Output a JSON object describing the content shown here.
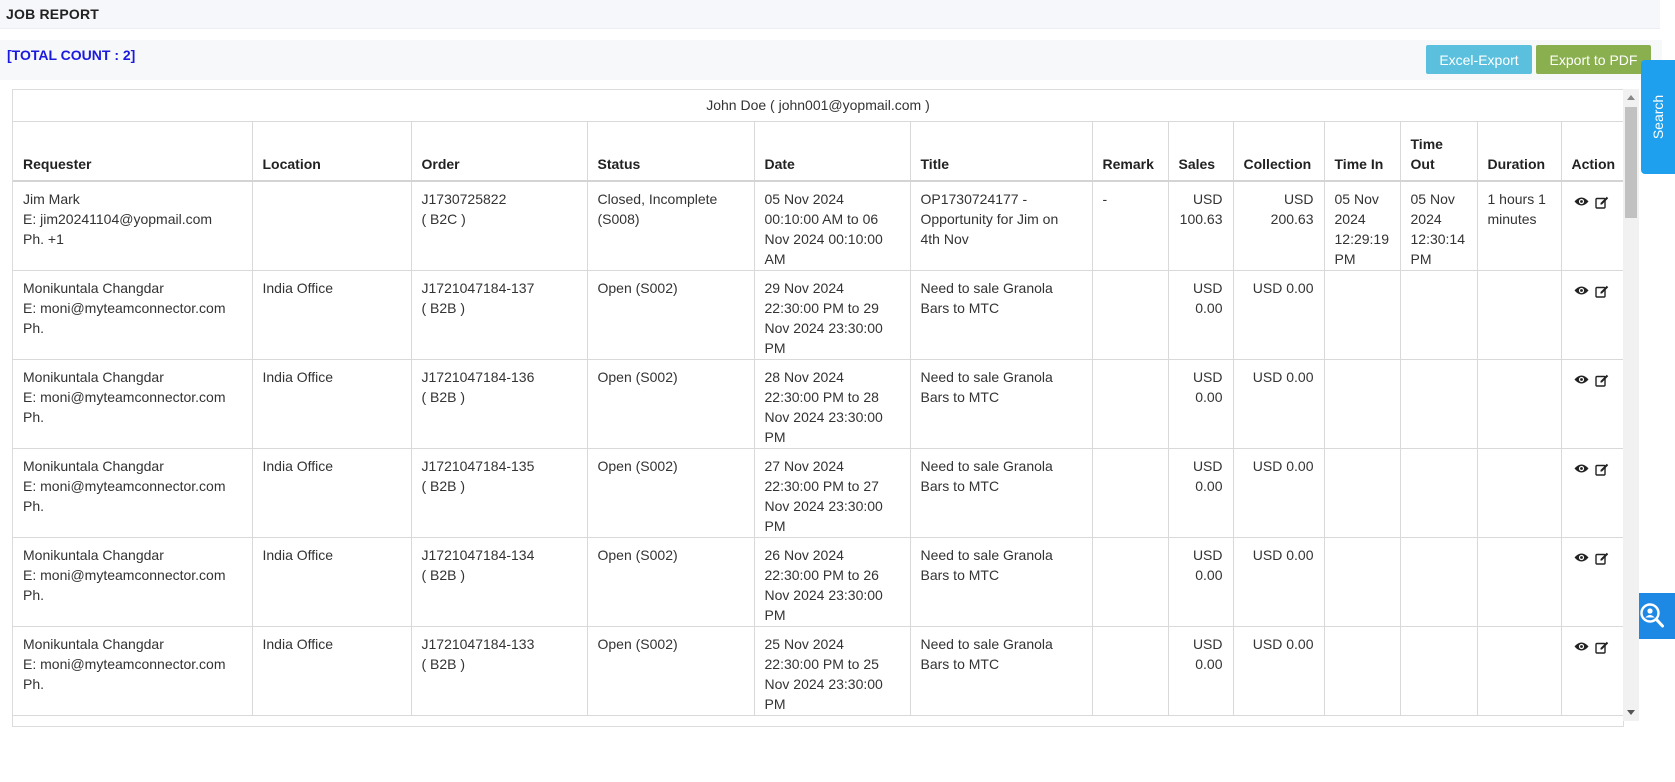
{
  "header": {
    "title": "JOB REPORT"
  },
  "summary": {
    "total_count": "[TOTAL COUNT : 2]"
  },
  "toolbar": {
    "excel_label": "Excel-Export",
    "pdf_label": "Export to PDF"
  },
  "side_tabs": {
    "search_label": "Search",
    "zoom_icon": "zoom-search-icon"
  },
  "table": {
    "group_header": "John Doe ( john001@yopmail.com )",
    "columns": [
      "Requester",
      "Location",
      "Order",
      "Status",
      "Date",
      "Title",
      "Remark",
      "Sales",
      "Collection",
      "Time In",
      "Time Out",
      "Duration",
      "Action"
    ],
    "rows": [
      {
        "req_name": "Jim Mark",
        "req_email": "E: jim20241104@yopmail.com",
        "req_phone": "Ph. +1",
        "location": "",
        "order_id": "J1730725822",
        "order_type": "( B2C )",
        "status": "Closed, Incomplete (S008)",
        "date": "05 Nov 2024 00:10:00 AM to 06 Nov 2024 00:10:00 AM",
        "title": "OP1730724177 - Opportunity for Jim on 4th Nov",
        "remark": "-",
        "sales": "USD 100.63",
        "collection": "USD 200.63",
        "time_in": "05 Nov 2024 12:29:19 PM",
        "time_out": "05 Nov 2024 12:30:14 PM",
        "duration": "1 hours 1 minutes"
      },
      {
        "req_name": "Monikuntala Changdar",
        "req_email": "E: moni@myteamconnector.com",
        "req_phone": "Ph.",
        "location": "India Office",
        "order_id": "J1721047184-137",
        "order_type": "( B2B )",
        "status": "Open (S002)",
        "date": "29 Nov 2024 22:30:00 PM to 29 Nov 2024 23:30:00 PM",
        "title": "Need to sale Granola Bars to MTC",
        "remark": "",
        "sales": "USD 0.00",
        "collection": "USD 0.00",
        "time_in": "",
        "time_out": "",
        "duration": ""
      },
      {
        "req_name": "Monikuntala Changdar",
        "req_email": "E: moni@myteamconnector.com",
        "req_phone": "Ph.",
        "location": "India Office",
        "order_id": "J1721047184-136",
        "order_type": "( B2B )",
        "status": "Open (S002)",
        "date": "28 Nov 2024 22:30:00 PM to 28 Nov 2024 23:30:00 PM",
        "title": "Need to sale Granola Bars to MTC",
        "remark": "",
        "sales": "USD 0.00",
        "collection": "USD 0.00",
        "time_in": "",
        "time_out": "",
        "duration": ""
      },
      {
        "req_name": "Monikuntala Changdar",
        "req_email": "E: moni@myteamconnector.com",
        "req_phone": "Ph.",
        "location": "India Office",
        "order_id": "J1721047184-135",
        "order_type": "( B2B )",
        "status": "Open (S002)",
        "date": "27 Nov 2024 22:30:00 PM to 27 Nov 2024 23:30:00 PM",
        "title": "Need to sale Granola Bars to MTC",
        "remark": "",
        "sales": "USD 0.00",
        "collection": "USD 0.00",
        "time_in": "",
        "time_out": "",
        "duration": ""
      },
      {
        "req_name": "Monikuntala Changdar",
        "req_email": "E: moni@myteamconnector.com",
        "req_phone": "Ph.",
        "location": "India Office",
        "order_id": "J1721047184-134",
        "order_type": "( B2B )",
        "status": "Open (S002)",
        "date": "26 Nov 2024 22:30:00 PM to 26 Nov 2024 23:30:00 PM",
        "title": "Need to sale Granola Bars to MTC",
        "remark": "",
        "sales": "USD 0.00",
        "collection": "USD 0.00",
        "time_in": "",
        "time_out": "",
        "duration": ""
      },
      {
        "req_name": "Monikuntala Changdar",
        "req_email": "E: moni@myteamconnector.com",
        "req_phone": "Ph.",
        "location": "India Office",
        "order_id": "J1721047184-133",
        "order_type": "( B2B )",
        "status": "Open (S002)",
        "date": "25 Nov 2024 22:30:00 PM to 25 Nov 2024 23:30:00 PM",
        "title": "Need to sale Granola Bars to MTC",
        "remark": "",
        "sales": "USD 0.00",
        "collection": "USD 0.00",
        "time_in": "",
        "time_out": "",
        "duration": ""
      }
    ]
  }
}
